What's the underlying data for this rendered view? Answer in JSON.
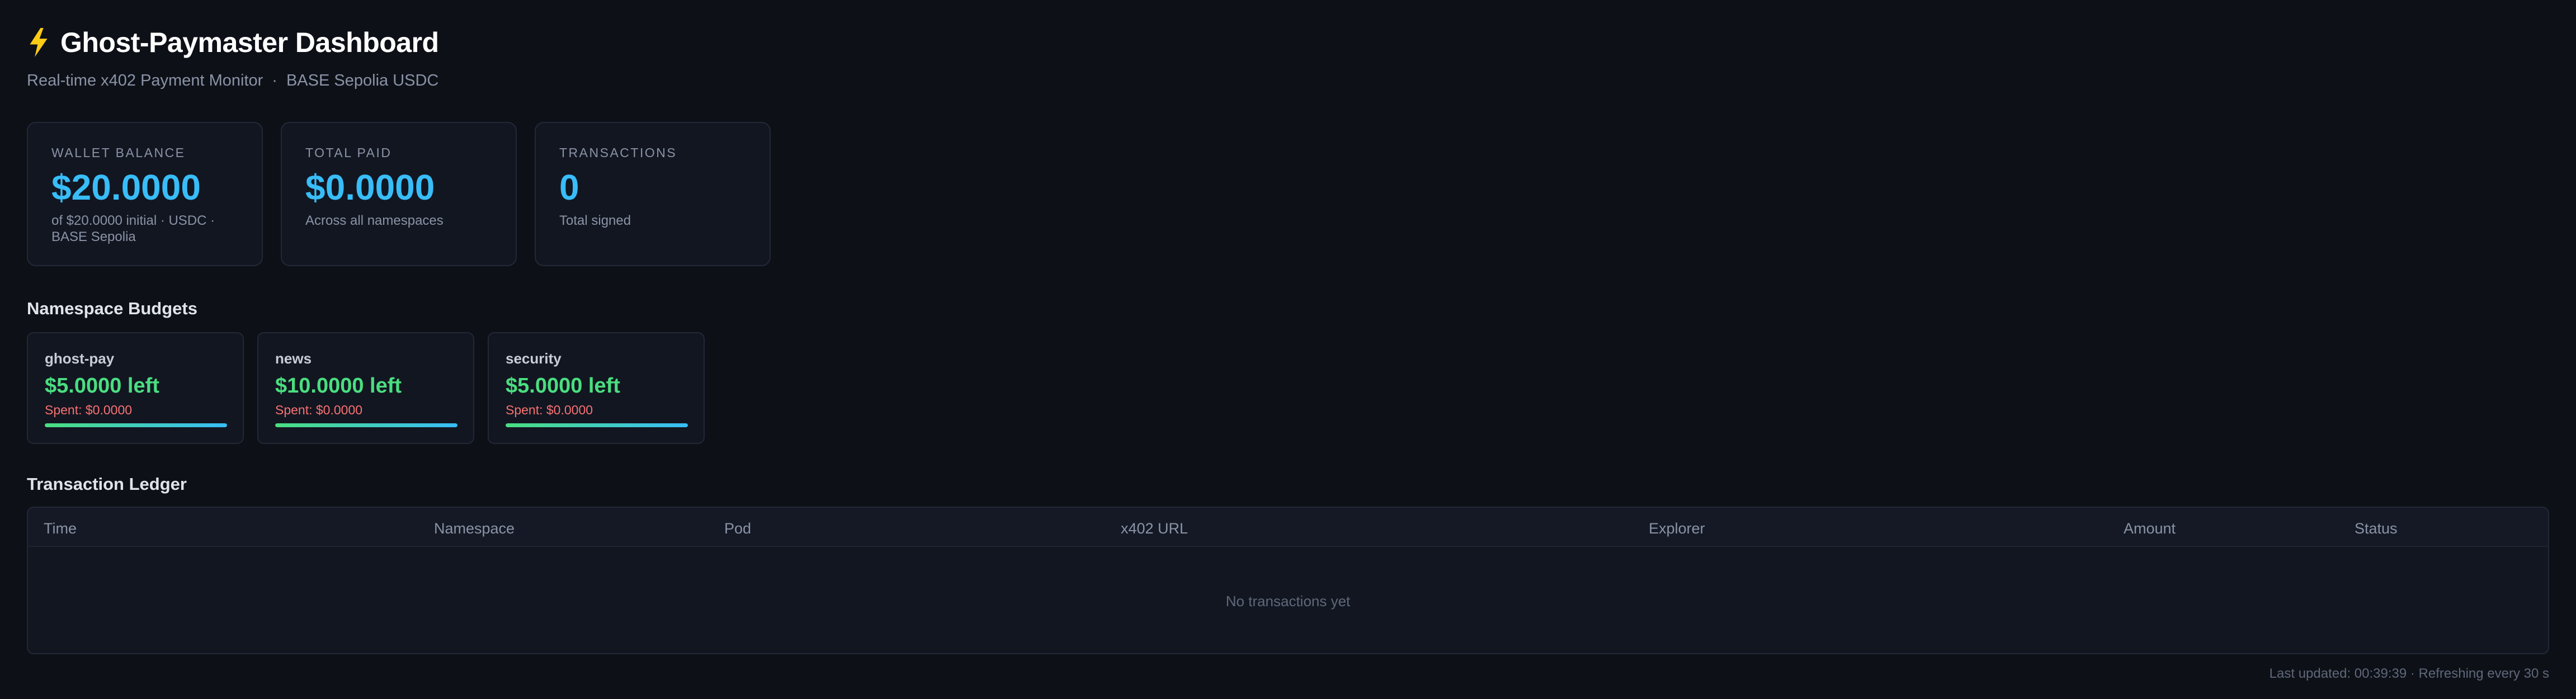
{
  "header": {
    "title": "Ghost-Paymaster Dashboard",
    "subtitle_left": "Real-time x402 Payment Monitor",
    "subtitle_sep": "·",
    "subtitle_right": "BASE Sepolia USDC",
    "icon": "lightning-bolt-icon"
  },
  "stats": [
    {
      "label": "WALLET BALANCE",
      "value": "$20.0000",
      "desc": "of $20.0000 initial · USDC · BASE Sepolia"
    },
    {
      "label": "TOTAL PAID",
      "value": "$0.0000",
      "desc": "Across all namespaces"
    },
    {
      "label": "TRANSACTIONS",
      "value": "0",
      "desc": "Total signed"
    }
  ],
  "namespaces": {
    "title": "Namespace Budgets",
    "items": [
      {
        "name": "ghost-pay",
        "left": "$5.0000 left",
        "spent": "Spent: $0.0000",
        "remaining_fraction": 1.0
      },
      {
        "name": "news",
        "left": "$10.0000 left",
        "spent": "Spent: $0.0000",
        "remaining_fraction": 1.0
      },
      {
        "name": "security",
        "left": "$5.0000 left",
        "spent": "Spent: $0.0000",
        "remaining_fraction": 1.0
      }
    ]
  },
  "ledger": {
    "title": "Transaction Ledger",
    "columns": [
      "Time",
      "Namespace",
      "Pod",
      "x402 URL",
      "Explorer",
      "Amount",
      "Status"
    ],
    "rows": [],
    "empty_text": "No transactions yet"
  },
  "footer": {
    "text": "Last updated: 00:39:39 · Refreshing every 30 s"
  },
  "colors": {
    "accent": "#38bdf8",
    "positive": "#4ade80",
    "negative": "#f87171",
    "background": "#0d1017",
    "card": "#121621"
  }
}
